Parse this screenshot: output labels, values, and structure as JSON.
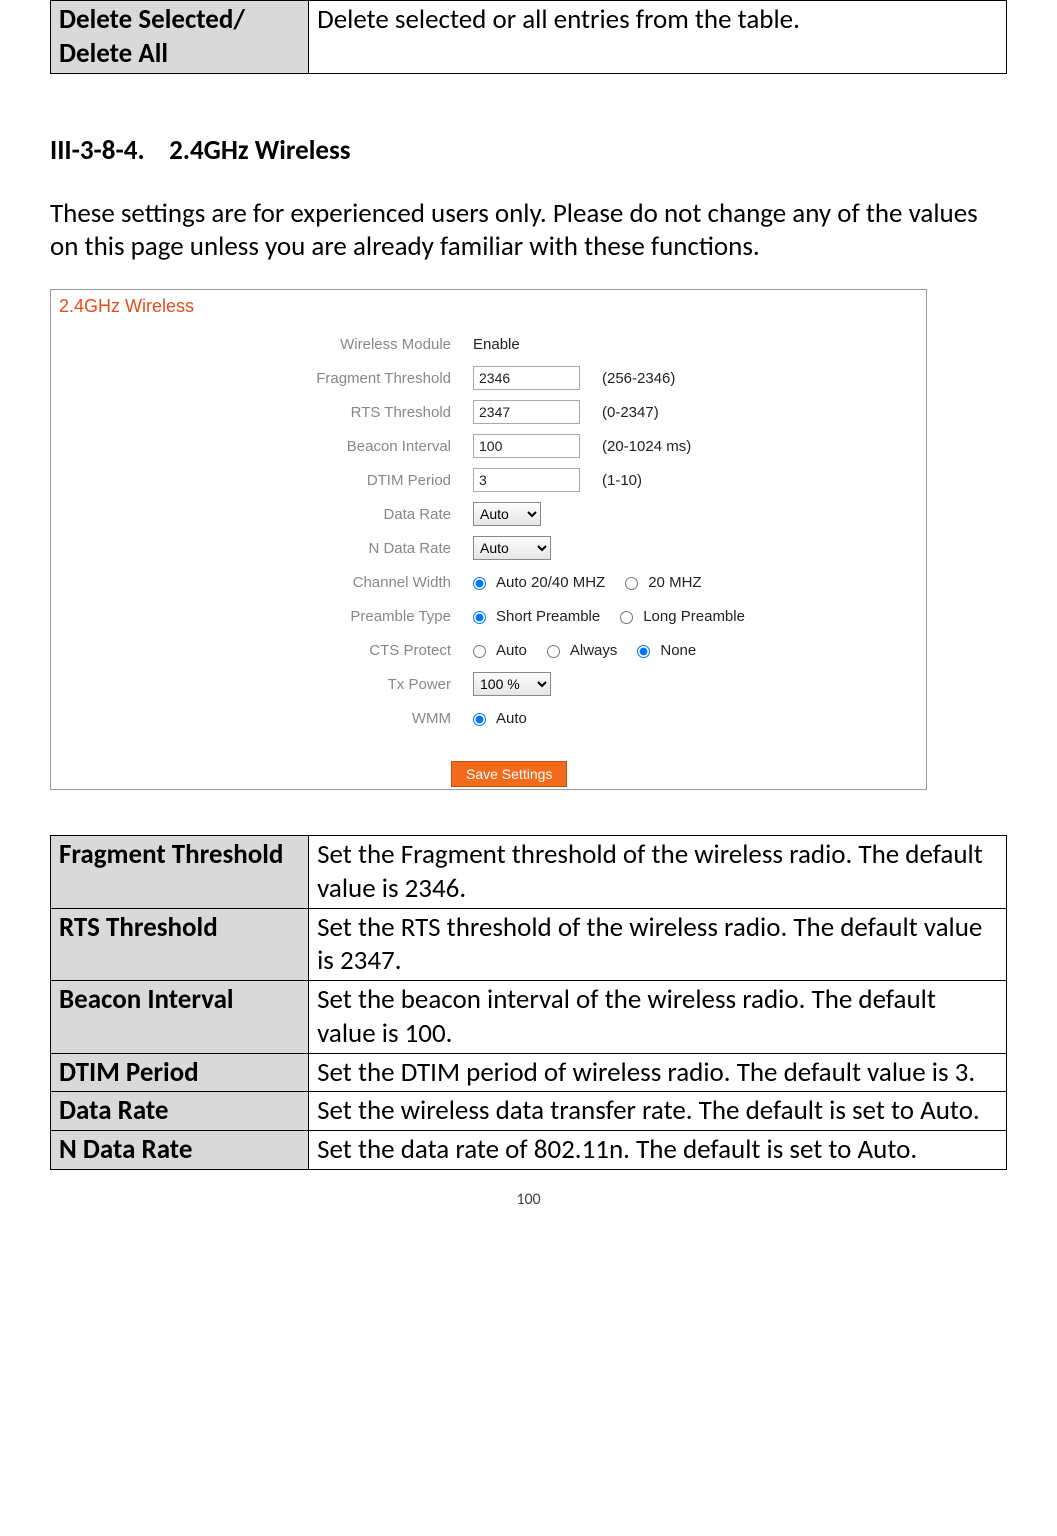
{
  "top_table": {
    "term": "Delete Selected/ Delete All",
    "desc": "Delete selected or all entries from the table."
  },
  "section": {
    "number": "III-3-8-4.",
    "title": "2.4GHz Wireless"
  },
  "intro": "These settings are for experienced users only. Please do not change any of the values on this page unless you are already familiar with these functions.",
  "screenshot": {
    "title": "2.4GHz Wireless",
    "rows": {
      "wireless_module": {
        "label": "Wireless Module",
        "value": "Enable"
      },
      "fragment_threshold": {
        "label": "Fragment Threshold",
        "value": "2346",
        "hint": "(256-2346)"
      },
      "rts_threshold": {
        "label": "RTS Threshold",
        "value": "2347",
        "hint": "(0-2347)"
      },
      "beacon_interval": {
        "label": "Beacon Interval",
        "value": "100",
        "hint": "(20-1024 ms)"
      },
      "dtim_period": {
        "label": "DTIM Period",
        "value": "3",
        "hint": "(1-10)"
      },
      "data_rate": {
        "label": "Data Rate",
        "value": "Auto"
      },
      "n_data_rate": {
        "label": "N Data Rate",
        "value": "Auto"
      },
      "channel_width": {
        "label": "Channel Width",
        "opt1": "Auto 20/40 MHZ",
        "opt2": "20 MHZ"
      },
      "preamble_type": {
        "label": "Preamble Type",
        "opt1": "Short Preamble",
        "opt2": "Long Preamble"
      },
      "cts_protect": {
        "label": "CTS Protect",
        "opt1": "Auto",
        "opt2": "Always",
        "opt3": "None"
      },
      "tx_power": {
        "label": "Tx Power",
        "value": "100 %"
      },
      "wmm": {
        "label": "WMM",
        "opt1": "Auto"
      }
    },
    "save_button": "Save Settings"
  },
  "desc_table": {
    "rows": [
      {
        "term": "Fragment Threshold",
        "desc": "Set the Fragment threshold of the wireless radio. The default value is 2346."
      },
      {
        "term": "RTS Threshold",
        "desc": "Set the RTS threshold of the wireless radio. The default value is 2347."
      },
      {
        "term": "Beacon Interval",
        "desc": "Set the beacon interval of the wireless radio. The default value is 100."
      },
      {
        "term": "DTIM Period",
        "desc": "Set the DTIM period of wireless radio. The default value is 3."
      },
      {
        "term": "Data Rate",
        "desc": "Set the wireless data transfer rate. The default is set to Auto."
      },
      {
        "term": "N Data Rate",
        "desc": "Set the data rate of 802.11n. The default is set to Auto."
      }
    ]
  },
  "page_number": "100"
}
